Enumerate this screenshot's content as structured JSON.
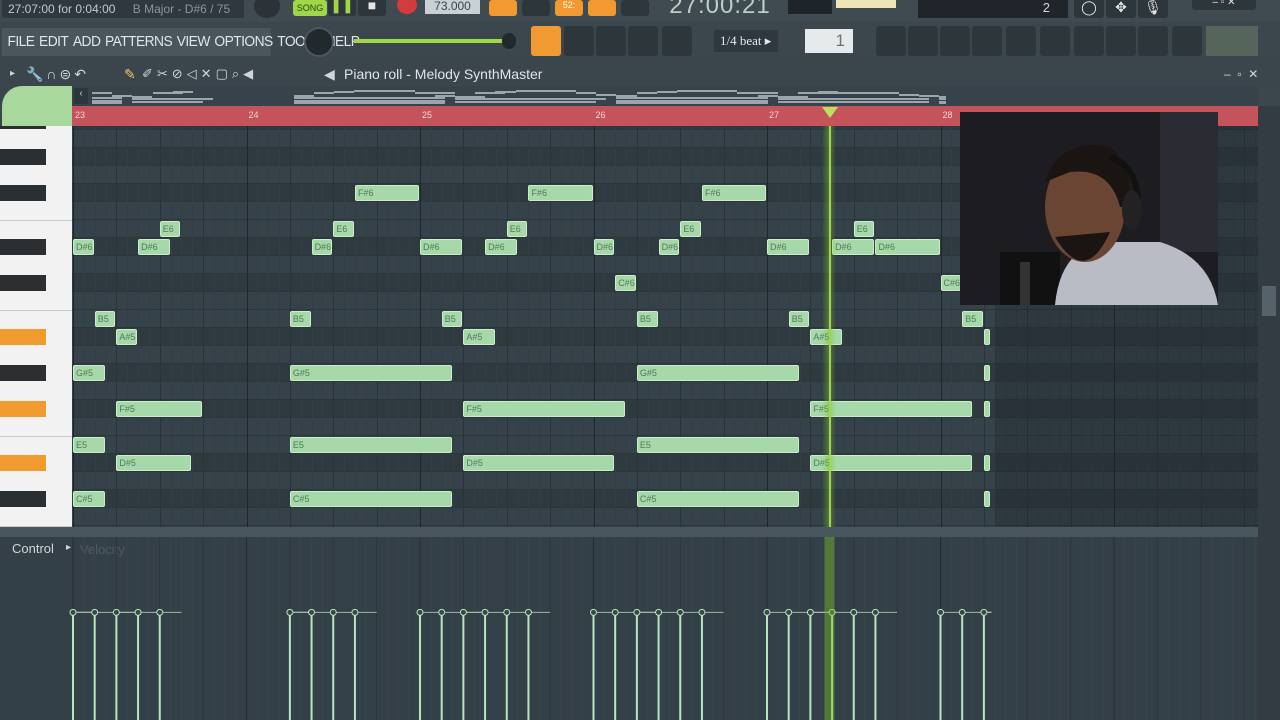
{
  "transport": {
    "hint": "27:07:00 for 0:04:00",
    "scale_hint": "B Major - D#6 / 75",
    "mode": "SONG",
    "tempo": "73.000",
    "time": "27:00:21",
    "pattern_count": "2",
    "pattern_label": "52:"
  },
  "menu": [
    "FILE",
    "EDIT",
    "ADD",
    "PATTERNS",
    "VIEW",
    "OPTIONS",
    "TOOLS",
    "HELP"
  ],
  "toolbar": {
    "snap": "1/4 beat",
    "pattern_number": "1"
  },
  "piano_roll": {
    "title": "Piano roll - Melody SynthMaster",
    "bars": [
      "23",
      "24",
      "25",
      "26",
      "27",
      "28"
    ],
    "playhead_bar": 27.36,
    "control_label": "Control",
    "control_target": "Velocity",
    "velocity_level": 0.78
  },
  "colors": {
    "note": "#a7d8a9",
    "ruler": "#c4535c",
    "accent": "#f19a2f",
    "playhead": "#9fd64a"
  },
  "notes": [
    {
      "label": "F#6",
      "midi": 90,
      "start": 26,
      "len": 6
    },
    {
      "label": "F#6",
      "midi": 90,
      "start": 42,
      "len": 6
    },
    {
      "label": "F#6",
      "midi": 90,
      "start": 58,
      "len": 6
    },
    {
      "label": "E6",
      "midi": 88,
      "start": 8,
      "len": 2
    },
    {
      "label": "E6",
      "midi": 88,
      "start": 24,
      "len": 2
    },
    {
      "label": "E6",
      "midi": 88,
      "start": 40,
      "len": 2
    },
    {
      "label": "E6",
      "midi": 88,
      "start": 56,
      "len": 2
    },
    {
      "label": "E6",
      "midi": 88,
      "start": 72,
      "len": 2
    },
    {
      "label": "D#6",
      "midi": 87,
      "start": 0,
      "len": 2
    },
    {
      "label": "D#6",
      "midi": 87,
      "start": 6,
      "len": 3
    },
    {
      "label": "D#6",
      "midi": 87,
      "start": 22,
      "len": 2
    },
    {
      "label": "D#6",
      "midi": 87,
      "start": 32,
      "len": 4
    },
    {
      "label": "D#6",
      "midi": 87,
      "start": 38,
      "len": 3
    },
    {
      "label": "D#6",
      "midi": 87,
      "start": 48,
      "len": 2
    },
    {
      "label": "D#6",
      "midi": 87,
      "start": 54,
      "len": 2
    },
    {
      "label": "D#6",
      "midi": 87,
      "start": 64,
      "len": 4
    },
    {
      "label": "D#6",
      "midi": 87,
      "start": 70,
      "len": 4
    },
    {
      "label": "D#6",
      "midi": 87,
      "start": 74,
      "len": 6
    },
    {
      "label": "C#6",
      "midi": 85,
      "start": 50,
      "len": 2
    },
    {
      "label": "C#6",
      "midi": 85,
      "start": 80,
      "len": 2
    },
    {
      "label": "B5",
      "midi": 83,
      "start": 2,
      "len": 2
    },
    {
      "label": "B5",
      "midi": 83,
      "start": 20,
      "len": 2
    },
    {
      "label": "B5",
      "midi": 83,
      "start": 34,
      "len": 2
    },
    {
      "label": "B5",
      "midi": 83,
      "start": 52,
      "len": 2
    },
    {
      "label": "B5",
      "midi": 83,
      "start": 66,
      "len": 2
    },
    {
      "label": "B5",
      "midi": 83,
      "start": 82,
      "len": 2
    },
    {
      "label": "A#5",
      "midi": 82,
      "start": 4,
      "len": 2
    },
    {
      "label": "A#5",
      "midi": 82,
      "start": 36,
      "len": 3
    },
    {
      "label": "A#5",
      "midi": 82,
      "start": 68,
      "len": 3
    },
    {
      "label": "",
      "midi": 82,
      "start": 84,
      "len": 0.7
    },
    {
      "label": "G#5",
      "midi": 80,
      "start": 0,
      "len": 3
    },
    {
      "label": "G#5",
      "midi": 80,
      "start": 20,
      "len": 15
    },
    {
      "label": "G#5",
      "midi": 80,
      "start": 52,
      "len": 15
    },
    {
      "label": "",
      "midi": 80,
      "start": 84,
      "len": 0.7
    },
    {
      "label": "F#5",
      "midi": 78,
      "start": 4,
      "len": 8
    },
    {
      "label": "F#5",
      "midi": 78,
      "start": 36,
      "len": 15
    },
    {
      "label": "F#5",
      "midi": 78,
      "start": 68,
      "len": 15
    },
    {
      "label": "",
      "midi": 78,
      "start": 84,
      "len": 0.7
    },
    {
      "label": "E5",
      "midi": 76,
      "start": 0,
      "len": 3
    },
    {
      "label": "E5",
      "midi": 76,
      "start": 20,
      "len": 15
    },
    {
      "label": "E5",
      "midi": 76,
      "start": 52,
      "len": 15
    },
    {
      "label": "D#5",
      "midi": 75,
      "start": 4,
      "len": 7
    },
    {
      "label": "D#5",
      "midi": 75,
      "start": 36,
      "len": 14
    },
    {
      "label": "D#5",
      "midi": 75,
      "start": 68,
      "len": 15
    },
    {
      "label": "",
      "midi": 75,
      "start": 84,
      "len": 0.7
    },
    {
      "label": "C#5",
      "midi": 73,
      "start": 0,
      "len": 3
    },
    {
      "label": "C#5",
      "midi": 73,
      "start": 20,
      "len": 15
    },
    {
      "label": "C#5",
      "midi": 73,
      "start": 52,
      "len": 15
    },
    {
      "label": "",
      "midi": 73,
      "start": 84,
      "len": 0.7
    }
  ],
  "highlighted_keys": [
    82,
    78,
    75
  ]
}
